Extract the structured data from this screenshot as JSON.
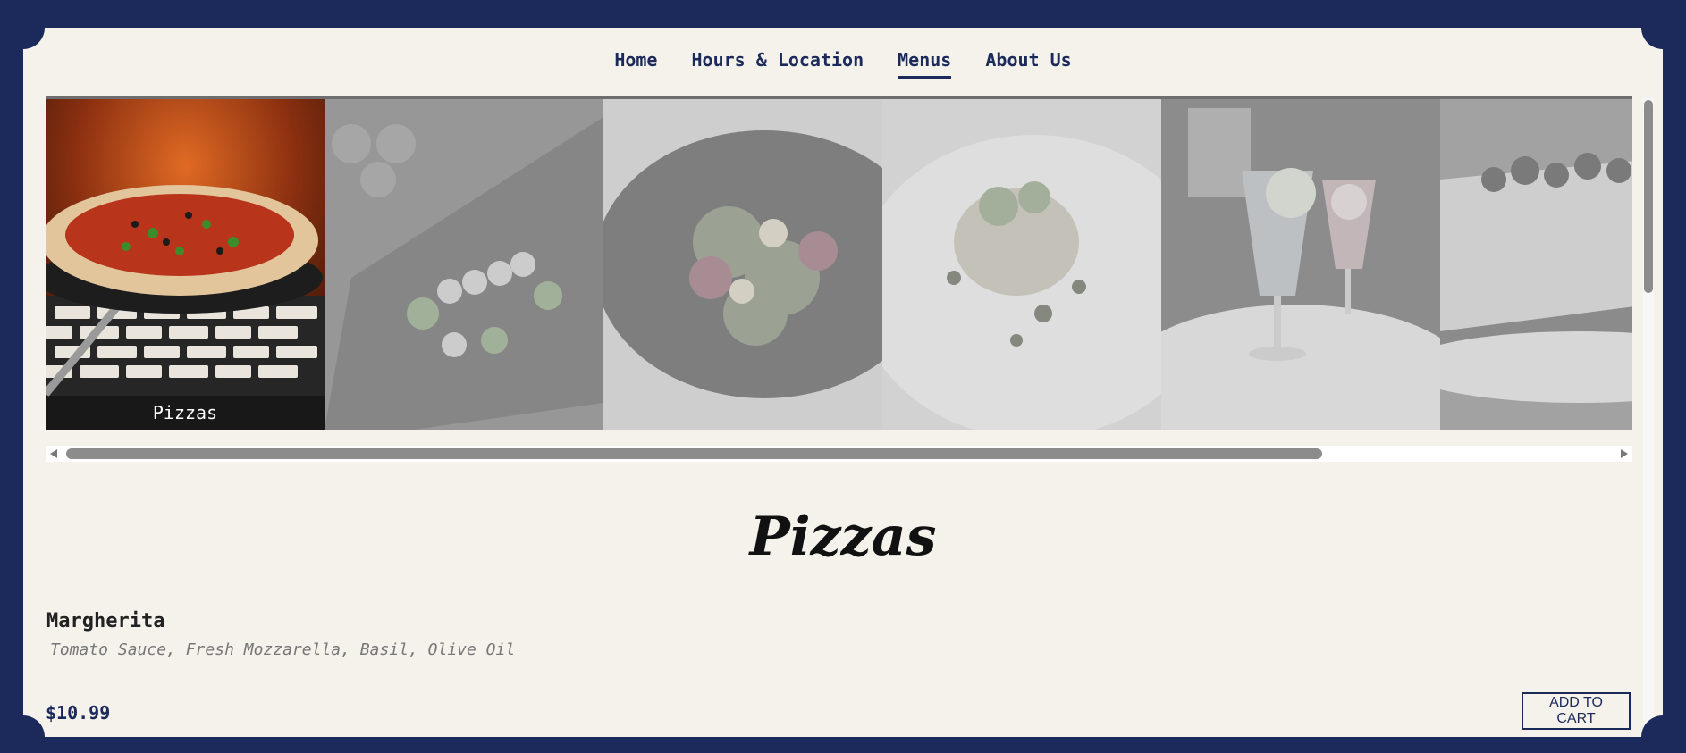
{
  "nav": {
    "items": [
      {
        "label": "Home"
      },
      {
        "label": "Hours & Location"
      },
      {
        "label": "Menus"
      },
      {
        "label": "About Us"
      }
    ],
    "active": "Menus"
  },
  "carousel": {
    "tiles": [
      {
        "label": "Pizzas",
        "icon": "pizza-photo"
      },
      {
        "label": "",
        "icon": "skewers-photo"
      },
      {
        "label": "",
        "icon": "salad-photo"
      },
      {
        "label": "",
        "icon": "plated-dish-photo"
      },
      {
        "label": "",
        "icon": "cocktails-photo"
      },
      {
        "label": "",
        "icon": "dessert-photo"
      }
    ]
  },
  "section": {
    "title": "Pizzas",
    "items": [
      {
        "name": "Margherita",
        "description": "Tomato Sauce, Fresh Mozzarella, Basil, Olive Oil",
        "price": "$10.99",
        "button": "ADD TO CART"
      }
    ]
  },
  "colors": {
    "brand_navy": "#1b2a5a",
    "background": "#f5f2ec"
  }
}
